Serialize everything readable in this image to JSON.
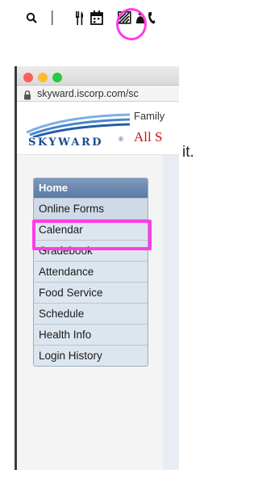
{
  "toolbar": {
    "icons": [
      "search-icon",
      "separator",
      "food-icon",
      "calendar-icon",
      "forms-icon",
      "bell-icon",
      "phone-icon"
    ],
    "highlight_color": "#ff3ce6"
  },
  "browser": {
    "traffic_lights": [
      "#ff5f57",
      "#febc2e",
      "#28c840"
    ],
    "url": "skyward.iscorp.com/sc"
  },
  "header": {
    "logo_text": "SKYWARD",
    "registered_mark": "®",
    "subtitle": "Family",
    "district": "All S"
  },
  "nav": {
    "home_label": "Home",
    "items": [
      {
        "label": "Online Forms"
      },
      {
        "label": "Calendar"
      },
      {
        "label": "Gradebook"
      },
      {
        "label": "Attendance"
      },
      {
        "label": "Food Service"
      },
      {
        "label": "Schedule"
      },
      {
        "label": "Health Info"
      },
      {
        "label": "Login History"
      }
    ]
  },
  "caption": {
    "trailing_text": "it."
  },
  "colors": {
    "brand_blue": "#1d4b8f",
    "district_red": "#c41414",
    "nav_header": "#6a88b0",
    "nav_item_bg": "#dde6ef"
  }
}
